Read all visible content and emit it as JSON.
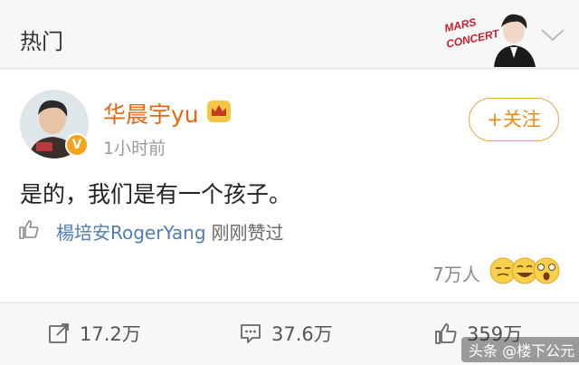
{
  "header": {
    "title": "热门",
    "banner_text": "MARS CONCERT",
    "expand_icon": "chevron-down-icon"
  },
  "post": {
    "author": "华晨宇yu",
    "verified_badge": "V",
    "time": "1小时前",
    "follow_label": "+关注",
    "content": "是的，我们是有一个孩子。",
    "liked_by_name": "楊培安RogerYang",
    "liked_by_suffix": "刚刚赞过",
    "reactions_count": "7万人"
  },
  "actions": {
    "repost": "17.2万",
    "comment": "37.6万",
    "like": "359万"
  },
  "watermark": "头条 @楼下公元",
  "colors": {
    "username": "#e8660f",
    "follow": "#f08a14",
    "link": "#4f7db4"
  }
}
